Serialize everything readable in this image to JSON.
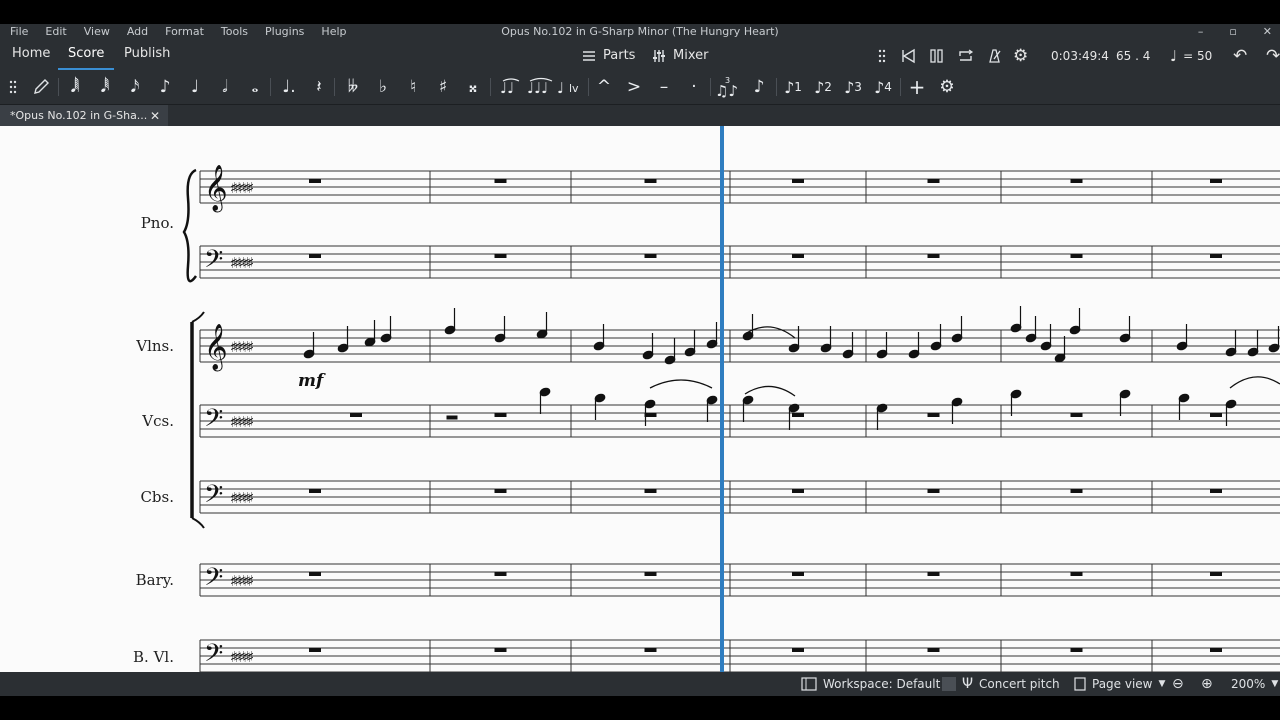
{
  "menu": [
    "File",
    "Edit",
    "View",
    "Add",
    "Format",
    "Tools",
    "Plugins",
    "Help"
  ],
  "window_title": "Opus No.102 in G-Sharp Minor (The Hungry Heart)",
  "nav": {
    "home": "Home",
    "score": "Score",
    "publish": "Publish",
    "parts": "Parts",
    "mixer": "Mixer",
    "time": "0:03:49:4",
    "position": "65 . 4",
    "tempo": "= 50"
  },
  "toolbar": {
    "voice_labels": [
      "1",
      "2",
      "3",
      "4"
    ],
    "icons": [
      "grip-icon",
      "pencil-icon",
      "sixty-fourth-note-icon",
      "thirty-second-note-icon",
      "sixteenth-note-icon",
      "eighth-note-icon",
      "quarter-note-icon",
      "half-note-icon",
      "whole-note-icon",
      "dot-icon",
      "rest-icon",
      "double-flat-icon",
      "flat-icon",
      "natural-icon",
      "sharp-icon",
      "double-sharp-icon",
      "tie-icon",
      "slur-icon",
      "tuplet-icon",
      "flip-icon",
      "marcato-icon",
      "accent-icon",
      "tenuto-icon",
      "staccato-icon",
      "triplet-icon",
      "grace-note-icon",
      "voice-1-icon",
      "voice-2-icon",
      "voice-3-icon",
      "voice-4-icon",
      "add-icon",
      "settings-icon"
    ]
  },
  "document_tab": "*Opus No.102 in G-Sha...",
  "instruments": [
    "Pno.",
    "Vlns.",
    "Vcs.",
    "Cbs.",
    "Bary.",
    "B. Vl."
  ],
  "dynamics": "mf",
  "status": {
    "workspace": "Workspace: Default",
    "concert_pitch": "Concert pitch",
    "page_view": "Page view",
    "zoom": "200%"
  }
}
